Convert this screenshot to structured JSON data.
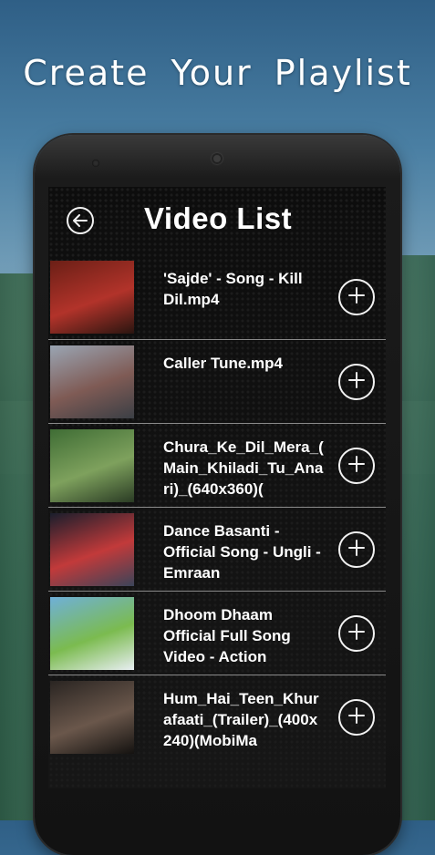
{
  "promo": {
    "headline": "Create  Your  Playlist"
  },
  "header": {
    "title": "Video List",
    "back_icon": "back-arrow-icon"
  },
  "videos": [
    {
      "title": "'Sajde' - Song - Kill Dil.mp4",
      "thumb_colors": [
        "#6b1f16",
        "#b2332a",
        "#2a1510"
      ]
    },
    {
      "title": "Caller Tune.mp4",
      "thumb_colors": [
        "#9aa5b3",
        "#7f5b55",
        "#3b3f45"
      ]
    },
    {
      "title": "Chura_Ke_Dil_Mera_(Main_Khiladi_Tu_Anari)_(640x360)(",
      "thumb_colors": [
        "#3f6d35",
        "#7ea15d",
        "#2a3b24"
      ]
    },
    {
      "title": "Dance Basanti - Official Song - Ungli - Emraan",
      "thumb_colors": [
        "#1a1e2c",
        "#c23a3a",
        "#3b4459"
      ]
    },
    {
      "title": "Dhoom Dhaam Official Full Song Video - Action",
      "thumb_colors": [
        "#6fb0d9",
        "#7bbb4f",
        "#e8eef2"
      ]
    },
    {
      "title": "Hum_Hai_Teen_Khurafaati_(Trailer)_(400x240)(MobiMa",
      "thumb_colors": [
        "#2a2522",
        "#6a574b",
        "#141210"
      ]
    }
  ],
  "add_icon": "plus-circle-icon"
}
